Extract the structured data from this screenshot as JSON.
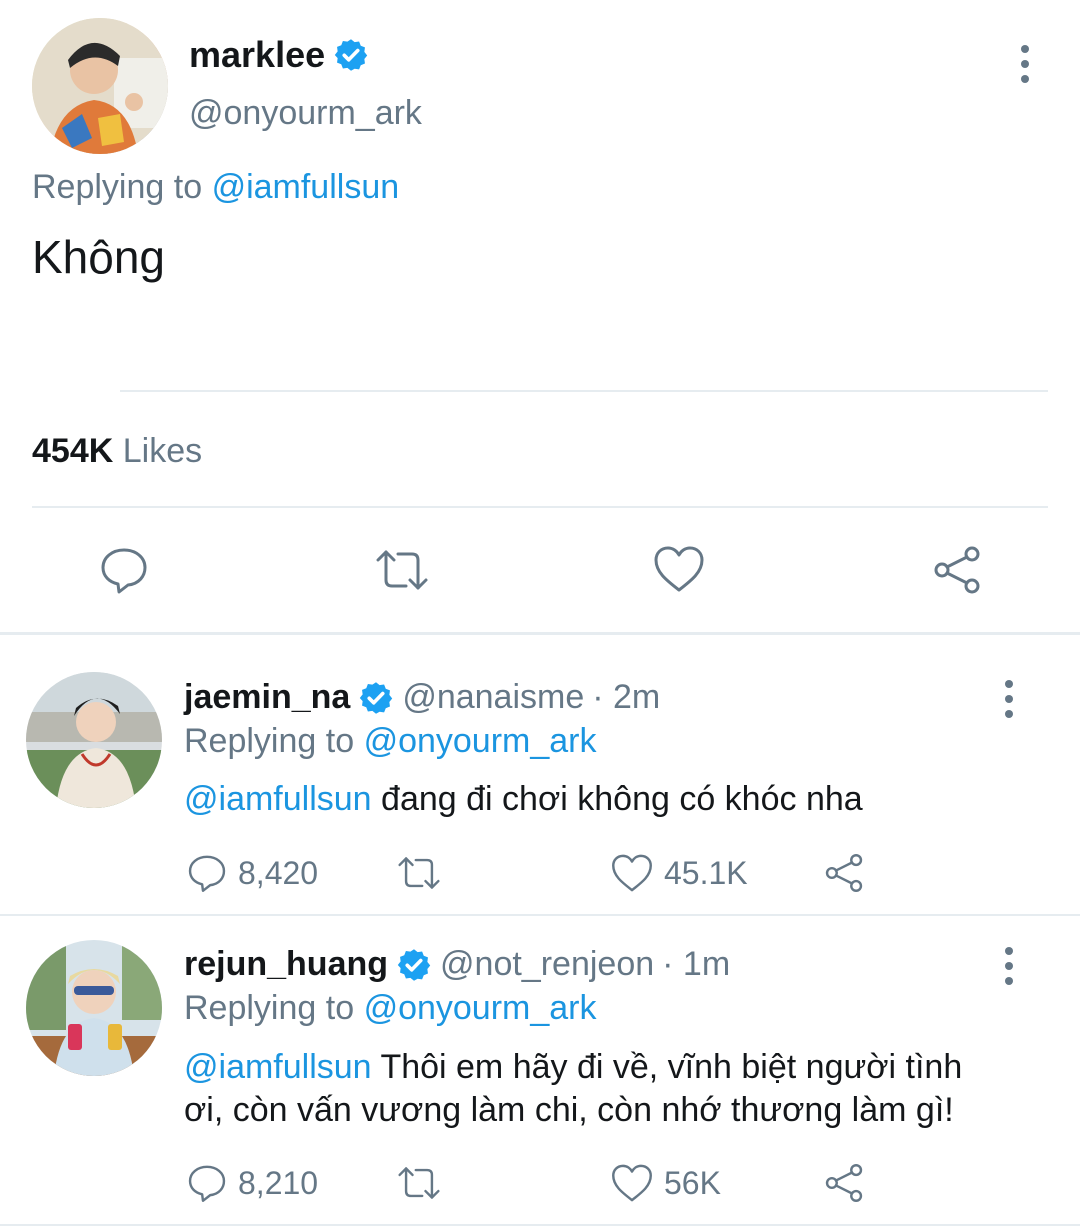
{
  "main_tweet": {
    "display_name": "marklee",
    "handle": "@onyourm_ark",
    "replying_prefix": "Replying to",
    "replying_to": "@iamfullsun",
    "text": "Không",
    "likes_count": "454K",
    "likes_label": "Likes",
    "actions": [
      "reply",
      "retweet",
      "like",
      "share"
    ]
  },
  "replies": [
    {
      "display_name": "jaemin_na",
      "handle": "@nanaisme",
      "time": "· 2m",
      "replying_prefix": "Replying to",
      "replying_to": "@onyourm_ark",
      "mention": "@iamfullsun",
      "text": "đang đi chơi không có khóc nha",
      "reply_count": "8,420",
      "retweet_count": "",
      "like_count": "45.1K"
    },
    {
      "display_name": "rejun_huang",
      "handle": "@not_renjeon",
      "time": "· 1m",
      "replying_prefix": "Replying to",
      "replying_to": "@onyourm_ark",
      "mention": "@iamfullsun",
      "text_line1": "Thôi em hãy đi về, vĩnh biệt người tình",
      "text_line2": "ơi, còn vấn vương làm chi, còn nhớ thương làm gì!",
      "reply_count": "8,210",
      "retweet_count": "",
      "like_count": "56K"
    }
  ],
  "colors": {
    "link": "#1b95e0",
    "muted": "#657786",
    "text": "#14171a",
    "divider": "#e6ecf0",
    "verified": "#1da1f2"
  }
}
